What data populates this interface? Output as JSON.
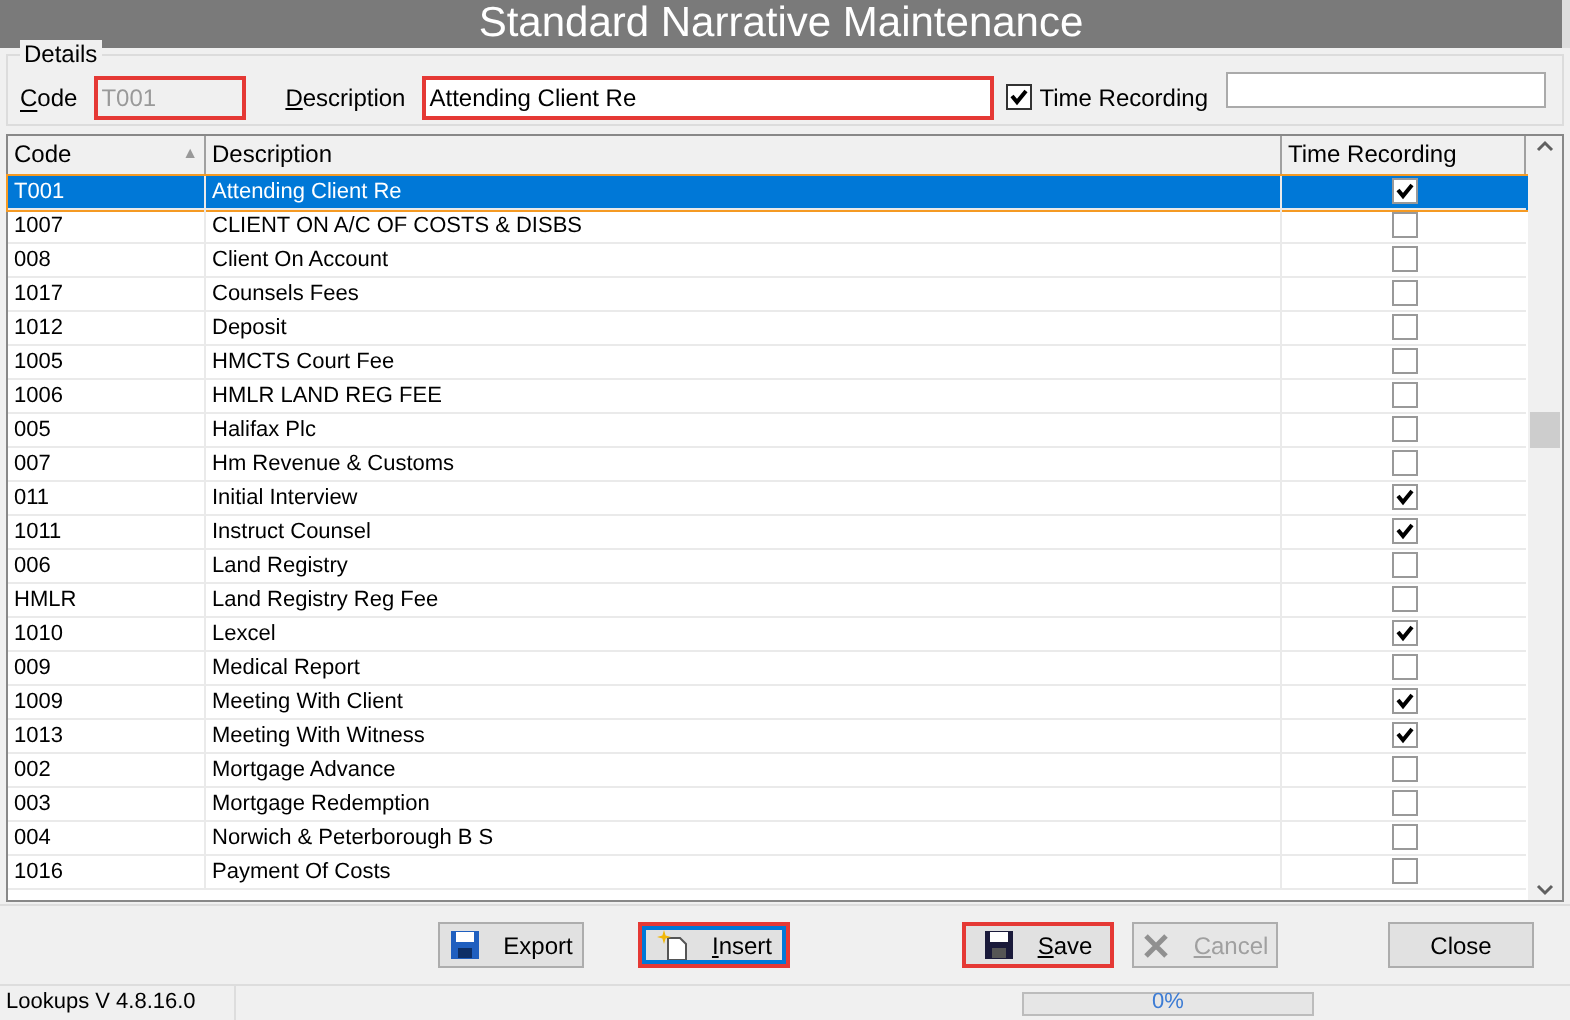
{
  "window": {
    "title": "Standard Narrative Maintenance"
  },
  "details": {
    "legend": "Details",
    "code": {
      "label": "Code",
      "value": "T001",
      "disabled": true,
      "highlighted": true
    },
    "description": {
      "label": "Description",
      "value": "Attending Client Re",
      "highlighted": true
    },
    "time_recording": {
      "label": "Time Recording",
      "checked": true
    }
  },
  "table": {
    "columns": [
      {
        "label": "Code",
        "sort": "▲"
      },
      {
        "label": "Description"
      },
      {
        "label": "Time Recording"
      }
    ],
    "rows": [
      {
        "code": "T001",
        "description": "Attending Client Re",
        "checked": true,
        "selected": true
      },
      {
        "code": "1007",
        "description": "CLIENT ON A/C OF COSTS & DISBS",
        "checked": false,
        "selected": false
      },
      {
        "code": "008",
        "description": "Client On Account",
        "checked": false,
        "selected": false
      },
      {
        "code": "1017",
        "description": "Counsels Fees",
        "checked": false,
        "selected": false
      },
      {
        "code": "1012",
        "description": "Deposit",
        "checked": false,
        "selected": false
      },
      {
        "code": "1005",
        "description": "HMCTS Court Fee",
        "checked": false,
        "selected": false
      },
      {
        "code": "1006",
        "description": "HMLR LAND REG FEE",
        "checked": false,
        "selected": false
      },
      {
        "code": "005",
        "description": "Halifax Plc",
        "checked": false,
        "selected": false
      },
      {
        "code": "007",
        "description": "Hm Revenue & Customs",
        "checked": false,
        "selected": false
      },
      {
        "code": "011",
        "description": "Initial Interview",
        "checked": true,
        "selected": false
      },
      {
        "code": "1011",
        "description": "Instruct Counsel",
        "checked": true,
        "selected": false
      },
      {
        "code": "006",
        "description": "Land Registry",
        "checked": false,
        "selected": false
      },
      {
        "code": "HMLR",
        "description": "Land Registry Reg Fee",
        "checked": false,
        "selected": false
      },
      {
        "code": "1010",
        "description": "Lexcel",
        "checked": true,
        "selected": false
      },
      {
        "code": "009",
        "description": "Medical Report",
        "checked": false,
        "selected": false
      },
      {
        "code": "1009",
        "description": "Meeting With Client",
        "checked": true,
        "selected": false
      },
      {
        "code": "1013",
        "description": "Meeting With Witness",
        "checked": true,
        "selected": false
      },
      {
        "code": "002",
        "description": "Mortgage Advance",
        "checked": false,
        "selected": false
      },
      {
        "code": "003",
        "description": "Mortgage Redemption",
        "checked": false,
        "selected": false
      },
      {
        "code": "004",
        "description": "Norwich & Peterborough B S",
        "checked": false,
        "selected": false
      },
      {
        "code": "1016",
        "description": "Payment Of Costs",
        "checked": false,
        "selected": false
      }
    ]
  },
  "buttons": [
    {
      "label": "Export",
      "kind": "export",
      "highlighted": false,
      "disabled": false
    },
    {
      "label": "Insert",
      "kind": "insert",
      "highlighted": true,
      "disabled": false
    },
    {
      "label": "Save",
      "kind": "save",
      "highlighted": true,
      "disabled": false
    },
    {
      "label": "Cancel",
      "kind": "cancel",
      "highlighted": false,
      "disabled": true
    },
    {
      "label": "Close",
      "kind": "close",
      "highlighted": false,
      "disabled": false
    }
  ],
  "status_bar": {
    "version": "Lookups V 4.8.16.0",
    "progress": {
      "level": 0,
      "reading": "0%"
    }
  }
}
